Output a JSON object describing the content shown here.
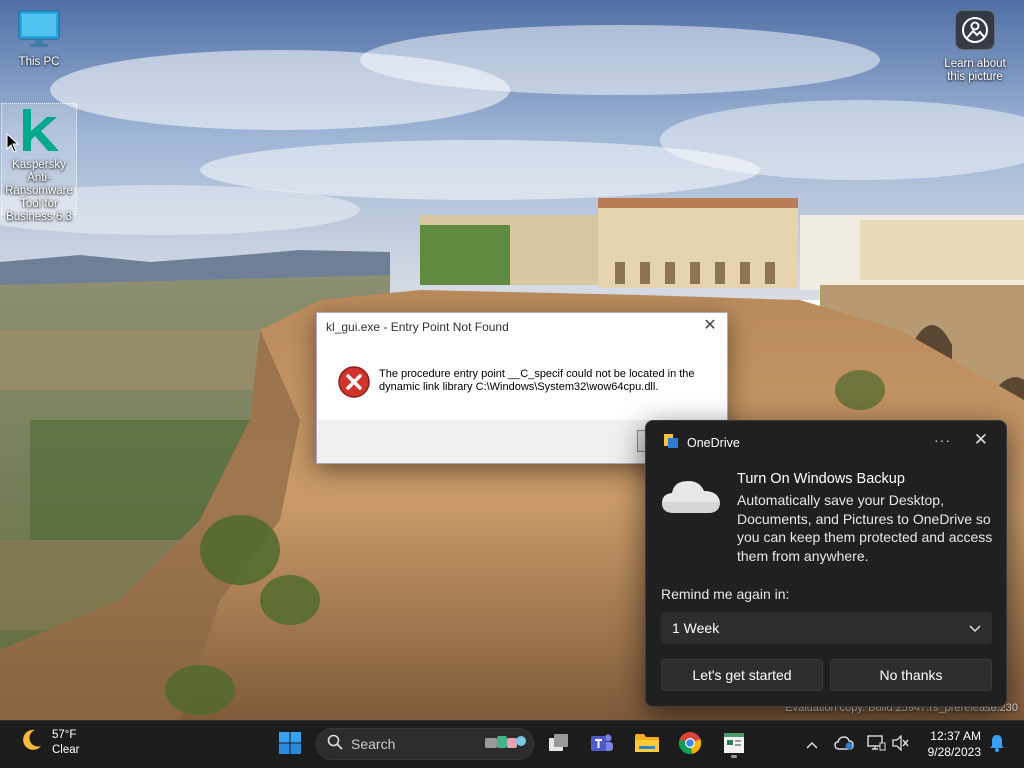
{
  "desktop": {
    "icons": [
      {
        "label": "This PC"
      },
      {
        "label": "Kaspersky Anti-Ransomware Tool for Business 6.3"
      },
      {
        "label": "Learn about this picture"
      }
    ]
  },
  "error_dialog": {
    "title": "kl_gui.exe - Entry Point Not Found",
    "message": "The procedure entry point __C_specif could not be located in the dynamic link library C:\\Windows\\System32\\wow64cpu.dll."
  },
  "toast": {
    "app_name": "OneDrive",
    "more_label": "···",
    "close_label": "✕",
    "heading": "Turn On Windows Backup",
    "body": "Automatically save your Desktop, Documents, and Pictures to OneDrive so you can keep them protected and access them from anywhere.",
    "remind_label": "Remind me again in:",
    "remind_value": "1 Week",
    "primary_button": "Let's get started",
    "secondary_button": "No thanks"
  },
  "watermark": {
    "text": "Evaluation copy. Build 25947.rs_prerelease.230"
  },
  "taskbar": {
    "weather_temp": "57°F",
    "weather_condition": "Clear",
    "search_label": "Search",
    "time": "12:37 AM",
    "date": "9/28/2023"
  },
  "colors": {
    "taskbar_bg": "#1c1c1c",
    "toast_bg": "#202020",
    "error_red": "#d0342c",
    "win_blue": "#0078d4",
    "kaspersky_green": "#00a88e"
  }
}
